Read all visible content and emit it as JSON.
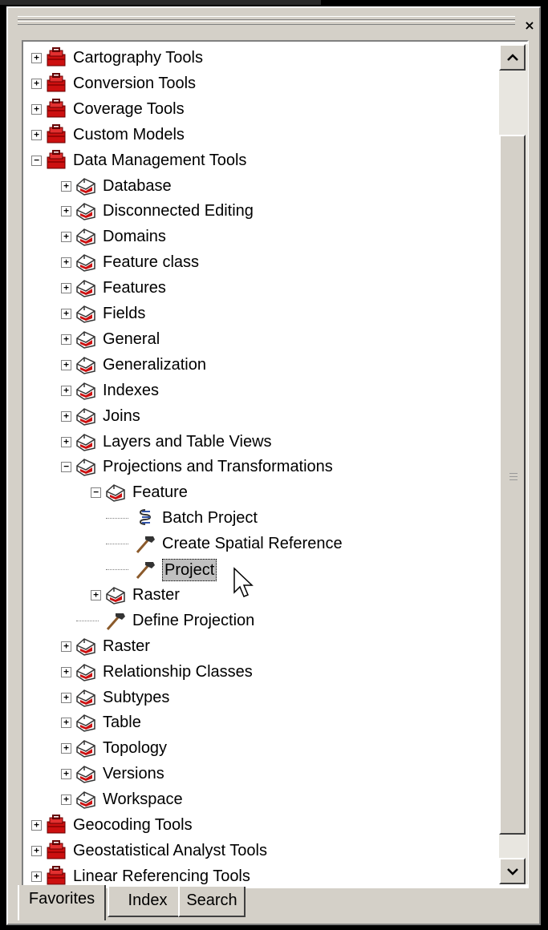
{
  "window": {
    "close_label": "×"
  },
  "tree": {
    "rows": [
      {
        "label": "Cartography Tools",
        "level": 0,
        "expander": "+",
        "icon": "toolbox-red-icon"
      },
      {
        "label": "Conversion Tools",
        "level": 0,
        "expander": "+",
        "icon": "toolbox-red-icon"
      },
      {
        "label": "Coverage Tools",
        "level": 0,
        "expander": "+",
        "icon": "toolbox-red-icon"
      },
      {
        "label": "Custom Models",
        "level": 0,
        "expander": "+",
        "icon": "toolbox-red-icon"
      },
      {
        "label": "Data Management Tools",
        "level": 0,
        "expander": "−",
        "icon": "toolbox-red-icon"
      },
      {
        "label": "Database",
        "level": 1,
        "expander": "+",
        "icon": "toolset-icon"
      },
      {
        "label": "Disconnected Editing",
        "level": 1,
        "expander": "+",
        "icon": "toolset-icon"
      },
      {
        "label": "Domains",
        "level": 1,
        "expander": "+",
        "icon": "toolset-icon"
      },
      {
        "label": "Feature class",
        "level": 1,
        "expander": "+",
        "icon": "toolset-icon"
      },
      {
        "label": "Features",
        "level": 1,
        "expander": "+",
        "icon": "toolset-icon"
      },
      {
        "label": "Fields",
        "level": 1,
        "expander": "+",
        "icon": "toolset-icon"
      },
      {
        "label": "General",
        "level": 1,
        "expander": "+",
        "icon": "toolset-icon"
      },
      {
        "label": "Generalization",
        "level": 1,
        "expander": "+",
        "icon": "toolset-icon"
      },
      {
        "label": "Indexes",
        "level": 1,
        "expander": "+",
        "icon": "toolset-icon"
      },
      {
        "label": "Joins",
        "level": 1,
        "expander": "+",
        "icon": "toolset-icon"
      },
      {
        "label": "Layers and Table Views",
        "level": 1,
        "expander": "+",
        "icon": "toolset-icon"
      },
      {
        "label": "Projections and Transformations",
        "level": 1,
        "expander": "−",
        "icon": "toolset-icon"
      },
      {
        "label": "Feature",
        "level": 2,
        "expander": "−",
        "icon": "toolset-icon"
      },
      {
        "label": "Batch Project",
        "level": 3,
        "expander": "",
        "icon": "script-icon"
      },
      {
        "label": "Create Spatial Reference",
        "level": 3,
        "expander": "",
        "icon": "hammer-icon"
      },
      {
        "label": "Project",
        "level": 3,
        "expander": "",
        "icon": "hammer-icon",
        "selected": true
      },
      {
        "label": "Raster",
        "level": 2,
        "expander": "+",
        "icon": "toolset-icon"
      },
      {
        "label": "Define Projection",
        "level": 2,
        "expander": "",
        "icon": "hammer-icon"
      },
      {
        "label": "Raster",
        "level": 1,
        "expander": "+",
        "icon": "toolset-icon"
      },
      {
        "label": "Relationship Classes",
        "level": 1,
        "expander": "+",
        "icon": "toolset-icon"
      },
      {
        "label": "Subtypes",
        "level": 1,
        "expander": "+",
        "icon": "toolset-icon"
      },
      {
        "label": "Table",
        "level": 1,
        "expander": "+",
        "icon": "toolset-icon"
      },
      {
        "label": "Topology",
        "level": 1,
        "expander": "+",
        "icon": "toolset-icon"
      },
      {
        "label": "Versions",
        "level": 1,
        "expander": "+",
        "icon": "toolset-icon"
      },
      {
        "label": "Workspace",
        "level": 1,
        "expander": "+",
        "icon": "toolset-icon"
      },
      {
        "label": "Geocoding Tools",
        "level": 0,
        "expander": "+",
        "icon": "toolbox-red-icon"
      },
      {
        "label": "Geostatistical Analyst Tools",
        "level": 0,
        "expander": "+",
        "icon": "toolbox-red-icon"
      },
      {
        "label": "Linear Referencing Tools",
        "level": 0,
        "expander": "+",
        "icon": "toolbox-red-icon"
      }
    ]
  },
  "tabs": [
    {
      "label": "Favorites",
      "active": true
    },
    {
      "label": "Index",
      "active": false
    },
    {
      "label": "Search",
      "active": false
    }
  ],
  "colors": {
    "toolbox_red": "#cc1010",
    "selection_bg": "#c0c0c0",
    "panel_bg": "#d4d0c8"
  }
}
